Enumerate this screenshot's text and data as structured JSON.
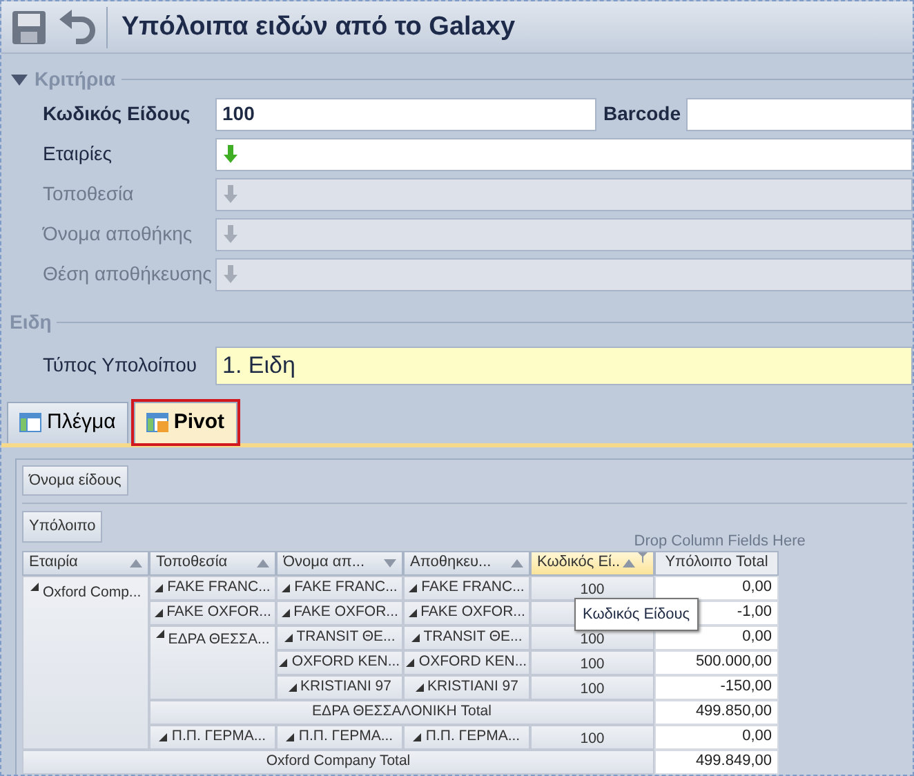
{
  "window": {
    "title": "Υπόλοιπα ειδών από το Galaxy"
  },
  "criteria": {
    "title": "Κριτήρια",
    "expanded": true,
    "rows": [
      {
        "label": "Κωδικός Είδους",
        "required": true,
        "kind": "text",
        "value": "100",
        "extra": {
          "label": "Barcode"
        }
      },
      {
        "label": "Εταιρίες",
        "required": false,
        "kind": "lookup",
        "disabled": false
      },
      {
        "label": "Τοποθεσία",
        "required": false,
        "kind": "lookup",
        "disabled": true
      },
      {
        "label": "Όνομα αποθήκης",
        "required": false,
        "kind": "lookup",
        "disabled": true
      },
      {
        "label": "Θέση αποθήκευσης",
        "required": false,
        "kind": "lookup",
        "disabled": true
      }
    ]
  },
  "items_section": {
    "title": "Ειδη",
    "rows": [
      {
        "label": "Τύπος Υπολοίπου",
        "required": false,
        "kind": "combo",
        "value": "1. Ειδη"
      }
    ]
  },
  "tabs": [
    {
      "label": "Πλέγμα",
      "selected": false,
      "highlighted": false
    },
    {
      "label": "Pivot",
      "selected": true,
      "highlighted": true
    }
  ],
  "pivot": {
    "filter_fields": [
      "Όνομα είδους"
    ],
    "data_fields": [
      "Υπόλοιπο"
    ],
    "column_hint": "Drop Column Fields Here",
    "row_headers": [
      {
        "label": "Εταιρία",
        "sort_descending": false,
        "highlighted": false,
        "filtered": false
      },
      {
        "label": "Τοποθεσία",
        "sort_descending": false,
        "highlighted": false,
        "filtered": false
      },
      {
        "label": "Όνομα απ...",
        "sort_descending": true,
        "highlighted": false,
        "filtered": false
      },
      {
        "label": "Αποθηκευ...",
        "sort_descending": false,
        "highlighted": false,
        "filtered": false
      },
      {
        "label": "Κωδικός Εί...",
        "sort_descending": false,
        "highlighted": true,
        "filtered": true
      }
    ],
    "value_header": "Υπόλοιπο Total",
    "rows": [
      {
        "label": "Oxford Comp...",
        "expanded": true,
        "total_label": "Oxford Company  Total",
        "total": "499.849,00",
        "children": [
          {
            "label": "FAKE FRANC...",
            "expanded": true,
            "children": [
              {
                "label": "FAKE FRANC...",
                "expanded": true,
                "children": [
                  {
                    "label": "FAKE FRANC...",
                    "expanded": true,
                    "children": [
                      {
                        "label": "100",
                        "value": "0,00"
                      }
                    ]
                  }
                ]
              }
            ]
          },
          {
            "label": "FAKE OXFOR...",
            "expanded": true,
            "children": [
              {
                "label": "FAKE OXFOR...",
                "expanded": true,
                "children": [
                  {
                    "label": "FAKE OXFOR...",
                    "expanded": true,
                    "children": [
                      {
                        "value": "-1,00"
                      }
                    ]
                  }
                ]
              }
            ]
          },
          {
            "label": "ΕΔΡΑ ΘΕΣΣΑ...",
            "expanded": true,
            "total_label": "ΕΔΡΑ ΘΕΣΣΑΛΟΝΙΚΗ Total",
            "total": "499.850,00",
            "children": [
              {
                "label": "TRANSIT ΘΕ...",
                "expanded": true,
                "children": [
                  {
                    "label": "TRANSIT ΘΕ...",
                    "expanded": true,
                    "children": [
                      {
                        "label": "100",
                        "value": "0,00"
                      }
                    ]
                  }
                ]
              },
              {
                "label": "OXFORD KEN...",
                "expanded": true,
                "children": [
                  {
                    "label": "OXFORD KEN...",
                    "expanded": true,
                    "children": [
                      {
                        "label": "100",
                        "value": "500.000,00"
                      }
                    ]
                  }
                ]
              },
              {
                "label": "KRISTIANI 97",
                "expanded": true,
                "children": [
                  {
                    "label": "KRISTIANI 97",
                    "expanded": true,
                    "children": [
                      {
                        "label": "100",
                        "value": "-150,00"
                      }
                    ]
                  }
                ]
              }
            ]
          },
          {
            "label": "Π.Π. ΓΕΡΜΑ...",
            "expanded": true,
            "children": [
              {
                "label": "Π.Π. ΓΕΡΜΑ...",
                "expanded": true,
                "children": [
                  {
                    "label": "Π.Π. ΓΕΡΜΑ...",
                    "expanded": true,
                    "children": [
                      {
                        "label": "100",
                        "value": "0,00"
                      }
                    ]
                  }
                ]
              }
            ]
          }
        ]
      }
    ],
    "tooltip": "Κωδικός Είδους"
  }
}
